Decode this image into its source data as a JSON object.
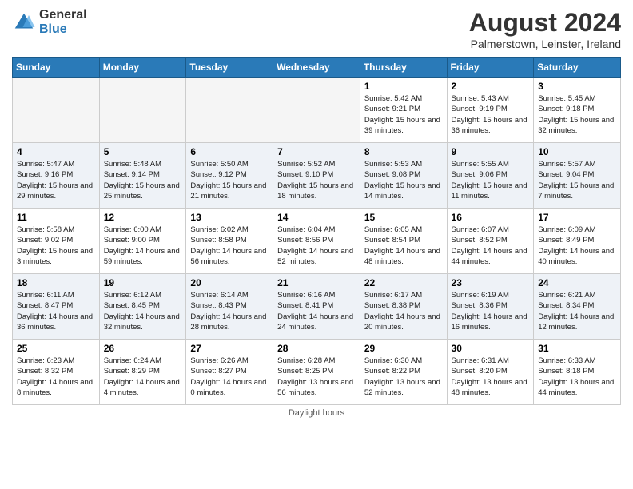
{
  "header": {
    "logo_general": "General",
    "logo_blue": "Blue",
    "month_year": "August 2024",
    "location": "Palmerstown, Leinster, Ireland"
  },
  "days_of_week": [
    "Sunday",
    "Monday",
    "Tuesday",
    "Wednesday",
    "Thursday",
    "Friday",
    "Saturday"
  ],
  "footer": "Daylight hours",
  "weeks": [
    [
      {
        "day": "",
        "sunrise": "",
        "sunset": "",
        "daylight": "",
        "empty": true
      },
      {
        "day": "",
        "sunrise": "",
        "sunset": "",
        "daylight": "",
        "empty": true
      },
      {
        "day": "",
        "sunrise": "",
        "sunset": "",
        "daylight": "",
        "empty": true
      },
      {
        "day": "",
        "sunrise": "",
        "sunset": "",
        "daylight": "",
        "empty": true
      },
      {
        "day": "1",
        "sunrise": "Sunrise: 5:42 AM",
        "sunset": "Sunset: 9:21 PM",
        "daylight": "Daylight: 15 hours and 39 minutes.",
        "empty": false
      },
      {
        "day": "2",
        "sunrise": "Sunrise: 5:43 AM",
        "sunset": "Sunset: 9:19 PM",
        "daylight": "Daylight: 15 hours and 36 minutes.",
        "empty": false
      },
      {
        "day": "3",
        "sunrise": "Sunrise: 5:45 AM",
        "sunset": "Sunset: 9:18 PM",
        "daylight": "Daylight: 15 hours and 32 minutes.",
        "empty": false
      }
    ],
    [
      {
        "day": "4",
        "sunrise": "Sunrise: 5:47 AM",
        "sunset": "Sunset: 9:16 PM",
        "daylight": "Daylight: 15 hours and 29 minutes.",
        "empty": false
      },
      {
        "day": "5",
        "sunrise": "Sunrise: 5:48 AM",
        "sunset": "Sunset: 9:14 PM",
        "daylight": "Daylight: 15 hours and 25 minutes.",
        "empty": false
      },
      {
        "day": "6",
        "sunrise": "Sunrise: 5:50 AM",
        "sunset": "Sunset: 9:12 PM",
        "daylight": "Daylight: 15 hours and 21 minutes.",
        "empty": false
      },
      {
        "day": "7",
        "sunrise": "Sunrise: 5:52 AM",
        "sunset": "Sunset: 9:10 PM",
        "daylight": "Daylight: 15 hours and 18 minutes.",
        "empty": false
      },
      {
        "day": "8",
        "sunrise": "Sunrise: 5:53 AM",
        "sunset": "Sunset: 9:08 PM",
        "daylight": "Daylight: 15 hours and 14 minutes.",
        "empty": false
      },
      {
        "day": "9",
        "sunrise": "Sunrise: 5:55 AM",
        "sunset": "Sunset: 9:06 PM",
        "daylight": "Daylight: 15 hours and 11 minutes.",
        "empty": false
      },
      {
        "day": "10",
        "sunrise": "Sunrise: 5:57 AM",
        "sunset": "Sunset: 9:04 PM",
        "daylight": "Daylight: 15 hours and 7 minutes.",
        "empty": false
      }
    ],
    [
      {
        "day": "11",
        "sunrise": "Sunrise: 5:58 AM",
        "sunset": "Sunset: 9:02 PM",
        "daylight": "Daylight: 15 hours and 3 minutes.",
        "empty": false
      },
      {
        "day": "12",
        "sunrise": "Sunrise: 6:00 AM",
        "sunset": "Sunset: 9:00 PM",
        "daylight": "Daylight: 14 hours and 59 minutes.",
        "empty": false
      },
      {
        "day": "13",
        "sunrise": "Sunrise: 6:02 AM",
        "sunset": "Sunset: 8:58 PM",
        "daylight": "Daylight: 14 hours and 56 minutes.",
        "empty": false
      },
      {
        "day": "14",
        "sunrise": "Sunrise: 6:04 AM",
        "sunset": "Sunset: 8:56 PM",
        "daylight": "Daylight: 14 hours and 52 minutes.",
        "empty": false
      },
      {
        "day": "15",
        "sunrise": "Sunrise: 6:05 AM",
        "sunset": "Sunset: 8:54 PM",
        "daylight": "Daylight: 14 hours and 48 minutes.",
        "empty": false
      },
      {
        "day": "16",
        "sunrise": "Sunrise: 6:07 AM",
        "sunset": "Sunset: 8:52 PM",
        "daylight": "Daylight: 14 hours and 44 minutes.",
        "empty": false
      },
      {
        "day": "17",
        "sunrise": "Sunrise: 6:09 AM",
        "sunset": "Sunset: 8:49 PM",
        "daylight": "Daylight: 14 hours and 40 minutes.",
        "empty": false
      }
    ],
    [
      {
        "day": "18",
        "sunrise": "Sunrise: 6:11 AM",
        "sunset": "Sunset: 8:47 PM",
        "daylight": "Daylight: 14 hours and 36 minutes.",
        "empty": false
      },
      {
        "day": "19",
        "sunrise": "Sunrise: 6:12 AM",
        "sunset": "Sunset: 8:45 PM",
        "daylight": "Daylight: 14 hours and 32 minutes.",
        "empty": false
      },
      {
        "day": "20",
        "sunrise": "Sunrise: 6:14 AM",
        "sunset": "Sunset: 8:43 PM",
        "daylight": "Daylight: 14 hours and 28 minutes.",
        "empty": false
      },
      {
        "day": "21",
        "sunrise": "Sunrise: 6:16 AM",
        "sunset": "Sunset: 8:41 PM",
        "daylight": "Daylight: 14 hours and 24 minutes.",
        "empty": false
      },
      {
        "day": "22",
        "sunrise": "Sunrise: 6:17 AM",
        "sunset": "Sunset: 8:38 PM",
        "daylight": "Daylight: 14 hours and 20 minutes.",
        "empty": false
      },
      {
        "day": "23",
        "sunrise": "Sunrise: 6:19 AM",
        "sunset": "Sunset: 8:36 PM",
        "daylight": "Daylight: 14 hours and 16 minutes.",
        "empty": false
      },
      {
        "day": "24",
        "sunrise": "Sunrise: 6:21 AM",
        "sunset": "Sunset: 8:34 PM",
        "daylight": "Daylight: 14 hours and 12 minutes.",
        "empty": false
      }
    ],
    [
      {
        "day": "25",
        "sunrise": "Sunrise: 6:23 AM",
        "sunset": "Sunset: 8:32 PM",
        "daylight": "Daylight: 14 hours and 8 minutes.",
        "empty": false
      },
      {
        "day": "26",
        "sunrise": "Sunrise: 6:24 AM",
        "sunset": "Sunset: 8:29 PM",
        "daylight": "Daylight: 14 hours and 4 minutes.",
        "empty": false
      },
      {
        "day": "27",
        "sunrise": "Sunrise: 6:26 AM",
        "sunset": "Sunset: 8:27 PM",
        "daylight": "Daylight: 14 hours and 0 minutes.",
        "empty": false
      },
      {
        "day": "28",
        "sunrise": "Sunrise: 6:28 AM",
        "sunset": "Sunset: 8:25 PM",
        "daylight": "Daylight: 13 hours and 56 minutes.",
        "empty": false
      },
      {
        "day": "29",
        "sunrise": "Sunrise: 6:30 AM",
        "sunset": "Sunset: 8:22 PM",
        "daylight": "Daylight: 13 hours and 52 minutes.",
        "empty": false
      },
      {
        "day": "30",
        "sunrise": "Sunrise: 6:31 AM",
        "sunset": "Sunset: 8:20 PM",
        "daylight": "Daylight: 13 hours and 48 minutes.",
        "empty": false
      },
      {
        "day": "31",
        "sunrise": "Sunrise: 6:33 AM",
        "sunset": "Sunset: 8:18 PM",
        "daylight": "Daylight: 13 hours and 44 minutes.",
        "empty": false
      }
    ]
  ]
}
